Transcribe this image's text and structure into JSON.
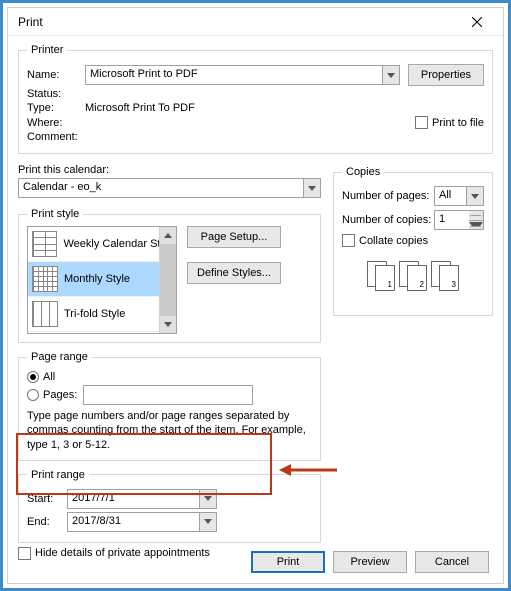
{
  "title": "Print",
  "printer": {
    "legend": "Printer",
    "name_label": "Name:",
    "name_value": "Microsoft Print to PDF",
    "properties_btn": "Properties",
    "status_label": "Status:",
    "type_label": "Type:",
    "type_value": "Microsoft Print To PDF",
    "where_label": "Where:",
    "comment_label": "Comment:",
    "print_to_file": "Print to file"
  },
  "print_calendar": {
    "label": "Print this calendar:",
    "value": "Calendar - eo_k"
  },
  "copies": {
    "legend": "Copies",
    "num_pages_label": "Number of pages:",
    "num_pages_value": "All",
    "num_copies_label": "Number of copies:",
    "num_copies_value": "1",
    "collate": "Collate copies"
  },
  "print_style": {
    "legend": "Print style",
    "items": [
      "Weekly Calendar Style",
      "Monthly Style",
      "Tri-fold Style"
    ],
    "page_setup_btn": "Page Setup...",
    "define_styles_btn": "Define Styles..."
  },
  "page_range": {
    "legend": "Page range",
    "all": "All",
    "pages": "Pages:",
    "hint": "Type page numbers and/or page ranges separated by commas counting from the start of the item.  For example, type 1, 3 or 5-12."
  },
  "print_range": {
    "legend": "Print range",
    "start_label": "Start:",
    "start_value": "2017/7/1",
    "end_label": "End:",
    "end_value": "2017/8/31"
  },
  "hide_private": "Hide details of private appointments",
  "buttons": {
    "print": "Print",
    "preview": "Preview",
    "cancel": "Cancel"
  },
  "copy_nums": [
    "1",
    "1",
    "2",
    "2",
    "3",
    "3"
  ]
}
